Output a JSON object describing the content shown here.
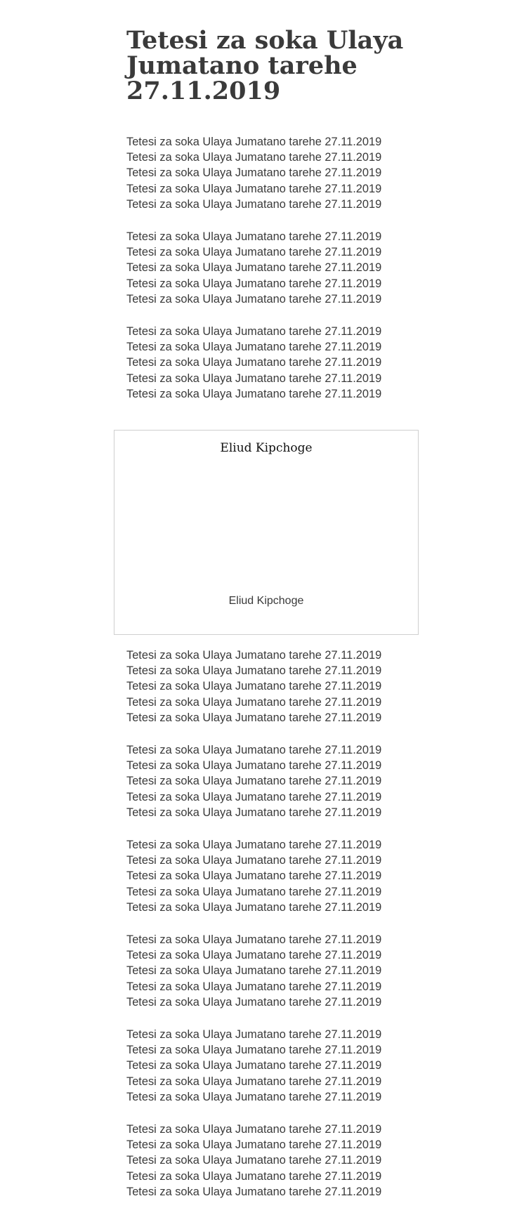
{
  "article": {
    "title": "Tetesi za soka Ulaya Jumatano tarehe 27.11.2019"
  },
  "paragraphs_top": [
    [
      "Tetesi za soka Ulaya Jumatano tarehe 27.11.2019",
      "Tetesi za soka Ulaya Jumatano tarehe 27.11.2019",
      "Tetesi za soka Ulaya Jumatano tarehe 27.11.2019",
      "Tetesi za soka Ulaya Jumatano tarehe 27.11.2019",
      "Tetesi za soka Ulaya Jumatano tarehe 27.11.2019"
    ],
    [
      "Tetesi za soka Ulaya Jumatano tarehe 27.11.2019",
      "Tetesi za soka Ulaya Jumatano tarehe 27.11.2019",
      "Tetesi za soka Ulaya Jumatano tarehe 27.11.2019",
      "Tetesi za soka Ulaya Jumatano tarehe 27.11.2019",
      "Tetesi za soka Ulaya Jumatano tarehe 27.11.2019"
    ],
    [
      "Tetesi za soka Ulaya Jumatano tarehe 27.11.2019",
      "Tetesi za soka Ulaya Jumatano tarehe 27.11.2019",
      "Tetesi za soka Ulaya Jumatano tarehe 27.11.2019",
      "Tetesi za soka Ulaya Jumatano tarehe 27.11.2019",
      "Tetesi za soka Ulaya Jumatano tarehe 27.11.2019"
    ]
  ],
  "figure": {
    "title": "Eliud Kipchoge",
    "caption": "Eliud Kipchoge"
  },
  "paragraphs_bottom": [
    [
      "Tetesi za soka Ulaya Jumatano tarehe 27.11.2019",
      "Tetesi za soka Ulaya Jumatano tarehe 27.11.2019",
      "Tetesi za soka Ulaya Jumatano tarehe 27.11.2019",
      "Tetesi za soka Ulaya Jumatano tarehe 27.11.2019",
      "Tetesi za soka Ulaya Jumatano tarehe 27.11.2019"
    ],
    [
      "Tetesi za soka Ulaya Jumatano tarehe 27.11.2019",
      "Tetesi za soka Ulaya Jumatano tarehe 27.11.2019",
      "Tetesi za soka Ulaya Jumatano tarehe 27.11.2019",
      "Tetesi za soka Ulaya Jumatano tarehe 27.11.2019",
      "Tetesi za soka Ulaya Jumatano tarehe 27.11.2019"
    ],
    [
      "Tetesi za soka Ulaya Jumatano tarehe 27.11.2019",
      "Tetesi za soka Ulaya Jumatano tarehe 27.11.2019",
      "Tetesi za soka Ulaya Jumatano tarehe 27.11.2019",
      "Tetesi za soka Ulaya Jumatano tarehe 27.11.2019",
      "Tetesi za soka Ulaya Jumatano tarehe 27.11.2019"
    ],
    [
      "Tetesi za soka Ulaya Jumatano tarehe 27.11.2019",
      "Tetesi za soka Ulaya Jumatano tarehe 27.11.2019",
      "Tetesi za soka Ulaya Jumatano tarehe 27.11.2019",
      "Tetesi za soka Ulaya Jumatano tarehe 27.11.2019",
      "Tetesi za soka Ulaya Jumatano tarehe 27.11.2019"
    ],
    [
      "Tetesi za soka Ulaya Jumatano tarehe 27.11.2019",
      "Tetesi za soka Ulaya Jumatano tarehe 27.11.2019",
      "Tetesi za soka Ulaya Jumatano tarehe 27.11.2019",
      "Tetesi za soka Ulaya Jumatano tarehe 27.11.2019",
      "Tetesi za soka Ulaya Jumatano tarehe 27.11.2019"
    ],
    [
      "Tetesi za soka Ulaya Jumatano tarehe 27.11.2019",
      "Tetesi za soka Ulaya Jumatano tarehe 27.11.2019",
      "Tetesi za soka Ulaya Jumatano tarehe 27.11.2019",
      "Tetesi za soka Ulaya Jumatano tarehe 27.11.2019",
      "Tetesi za soka Ulaya Jumatano tarehe 27.11.2019"
    ]
  ],
  "colors": {
    "text": "#3a3a3a",
    "figure_title": "#111111",
    "figure_border": "#cfcfcf",
    "background": "#ffffff"
  }
}
